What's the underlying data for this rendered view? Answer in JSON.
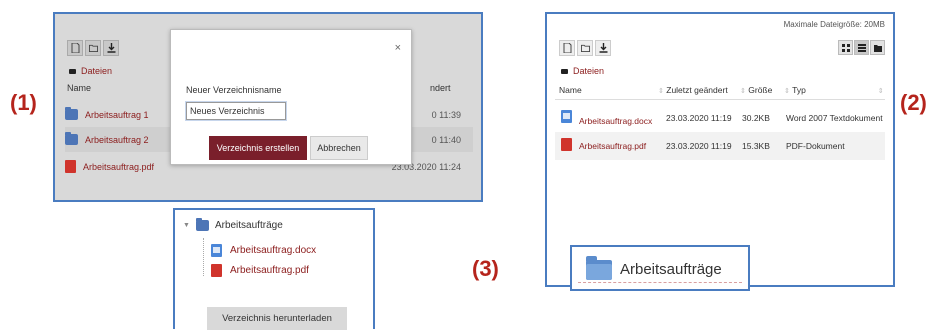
{
  "labels": {
    "one": "(1)",
    "two": "(2)",
    "three": "(3)"
  },
  "panel1": {
    "breadcrumb": "Dateien",
    "column_name": "Name",
    "column_modified_partial": "ndert",
    "files": [
      {
        "name": "Arbeitsauftrag 1",
        "type": "folder",
        "date": "0 11:39"
      },
      {
        "name": "Arbeitsauftrag 2",
        "type": "folder",
        "date": "0 11:40"
      },
      {
        "name": "Arbeitsauftrag.pdf",
        "type": "pdf",
        "date": "23.03.2020 11:24"
      }
    ],
    "modal": {
      "label": "Neuer Verzeichnisname",
      "input_value": "Neues Verzeichnis",
      "create_button": "Verzeichnis erstellen",
      "cancel_button": "Abbrechen",
      "close_symbol": "×"
    }
  },
  "panel2": {
    "max_size": "Maximale Dateigröße: 20MB",
    "breadcrumb": "Dateien",
    "columns": [
      "Name",
      "Zuletzt geändert",
      "Größe",
      "Typ"
    ],
    "rows": [
      {
        "name": "Arbeitsauftrag.docx",
        "modified": "23.03.2020 11:19",
        "size": "30.2KB",
        "type": "Word 2007 Textdokument",
        "icon": "docx-icon"
      },
      {
        "name": "Arbeitsauftrag.pdf",
        "modified": "23.03.2020 11:19",
        "size": "15.3KB",
        "type": "PDF-Dokument",
        "icon": "pdf-icon"
      }
    ]
  },
  "panel3": {
    "folder": "Arbeitsaufträge",
    "files": [
      "Arbeitsauftrag.docx",
      "Arbeitsauftrag.pdf"
    ],
    "download_button": "Verzeichnis herunterladen"
  },
  "panel4": {
    "folder": "Arbeitsaufträge"
  },
  "colors": {
    "accent": "#7a1f2b",
    "link": "#8b1c1c",
    "frame": "#4a7cc0",
    "folder": "#4d75b6"
  }
}
